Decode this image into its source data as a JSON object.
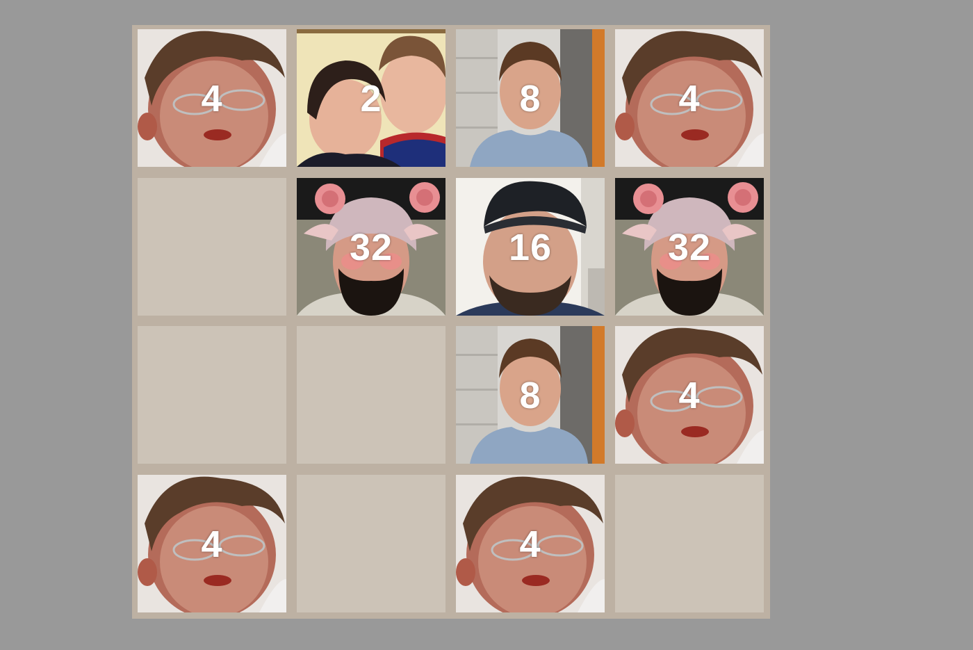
{
  "game": {
    "board": {
      "rows": 4,
      "cols": 4,
      "tiles": [
        [
          {
            "value": "4",
            "photo": "boy-glasses-face"
          },
          {
            "value": "2",
            "photo": "two-toddlers-photo"
          },
          {
            "value": "8",
            "photo": "boy-blue-hoodie"
          },
          {
            "value": "4",
            "photo": "boy-glasses-face"
          }
        ],
        [
          {
            "value": "",
            "photo": "empty"
          },
          {
            "value": "32",
            "photo": "bearded-man-sheep-hat"
          },
          {
            "value": "16",
            "photo": "man-black-cap"
          },
          {
            "value": "32",
            "photo": "bearded-man-sheep-hat"
          }
        ],
        [
          {
            "value": "",
            "photo": "empty"
          },
          {
            "value": "",
            "photo": "empty"
          },
          {
            "value": "8",
            "photo": "boy-blue-hoodie"
          },
          {
            "value": "4",
            "photo": "boy-glasses-face"
          }
        ],
        [
          {
            "value": "4",
            "photo": "boy-glasses-face"
          },
          {
            "value": "",
            "photo": "empty"
          },
          {
            "value": "4",
            "photo": "boy-glasses-face"
          },
          {
            "value": "",
            "photo": "empty"
          }
        ]
      ]
    },
    "colors": {
      "page_background": "#999999",
      "board_background": "#bdb1a3",
      "empty_cell": "#ccc3b7",
      "tile_text": "#ffffff"
    }
  }
}
